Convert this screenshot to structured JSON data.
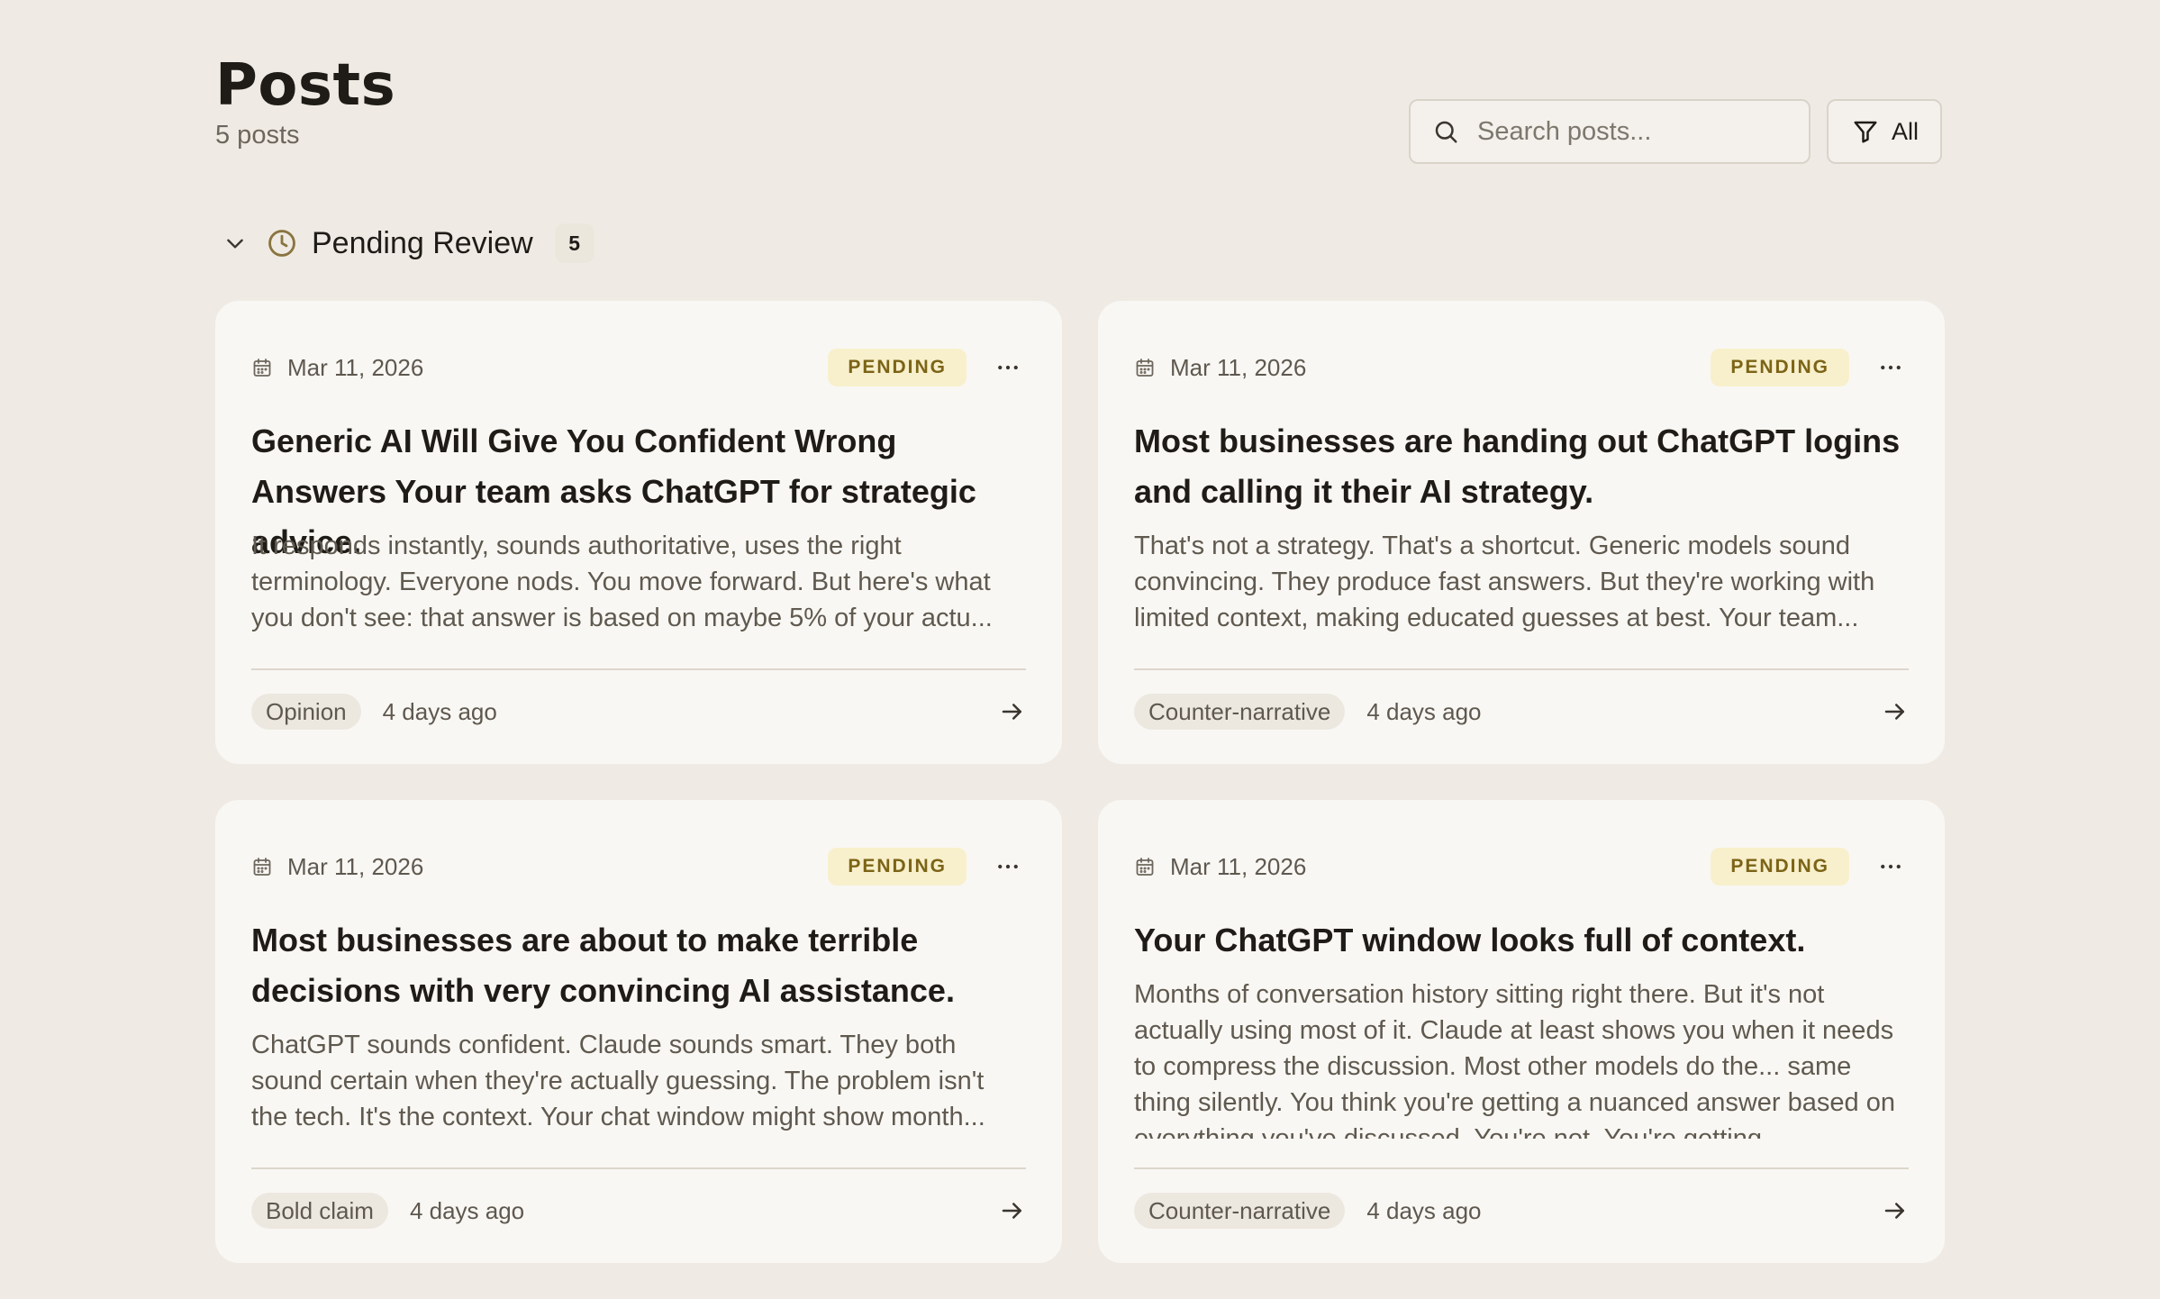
{
  "header": {
    "title": "Posts",
    "count_label": "5 posts"
  },
  "toolbar": {
    "search_placeholder": "Search posts...",
    "filter_label": "All"
  },
  "group": {
    "title": "Pending Review",
    "count": "5"
  },
  "cards": [
    {
      "date": "Mar 11, 2026",
      "status": "PENDING",
      "title": "Generic AI Will Give You Confident Wrong Answers Your team asks ChatGPT for strategic advice.",
      "excerpt": "It responds instantly, sounds authoritative, uses the right terminology. Everyone nods. You move forward. But here's what you don't see: that answer is based on maybe 5% of your actu...",
      "tag": "Opinion",
      "time_ago": "4 days ago"
    },
    {
      "date": "Mar 11, 2026",
      "status": "PENDING",
      "title": "Most businesses are handing out ChatGPT logins and calling it their AI strategy.",
      "excerpt": "That's not a strategy. That's a shortcut. Generic models sound convincing. They produce fast answers. But they're working with limited context, making educated guesses at best. Your team...",
      "tag": "Counter-narrative",
      "time_ago": "4 days ago"
    },
    {
      "date": "Mar 11, 2026",
      "status": "PENDING",
      "title": "Most businesses are about to make terrible decisions with very convincing AI assistance.",
      "excerpt": "ChatGPT sounds confident. Claude sounds smart. They both sound certain when they're actually guessing. The problem isn't the tech. It's the context. Your chat window might show month...",
      "tag": "Bold claim",
      "time_ago": "4 days ago"
    },
    {
      "date": "Mar 11, 2026",
      "status": "PENDING",
      "title": "Your ChatGPT window looks full of context.",
      "excerpt": "Months of conversation history sitting right there. But it's not actually using most of it. Claude at least shows you when it needs to compress the discussion. Most other models do the... same thing silently. You think you're getting a nuanced answer based on everything you've discussed. You're not. You're getting",
      "tag": "Counter-narrative",
      "time_ago": "4 days ago"
    }
  ],
  "colors": {
    "background": "#efebe4",
    "card": "#f9f7f3",
    "badge_bg": "#f8f0cc",
    "badge_text": "#7c6417",
    "clock_accent": "#8a7440"
  },
  "icons": {
    "search": "search-icon",
    "filter": "filter-icon",
    "chevron": "chevron-down-icon",
    "clock": "clock-icon",
    "calendar": "calendar-icon",
    "more": "more-horizontal-icon",
    "arrow": "arrow-right-icon"
  }
}
